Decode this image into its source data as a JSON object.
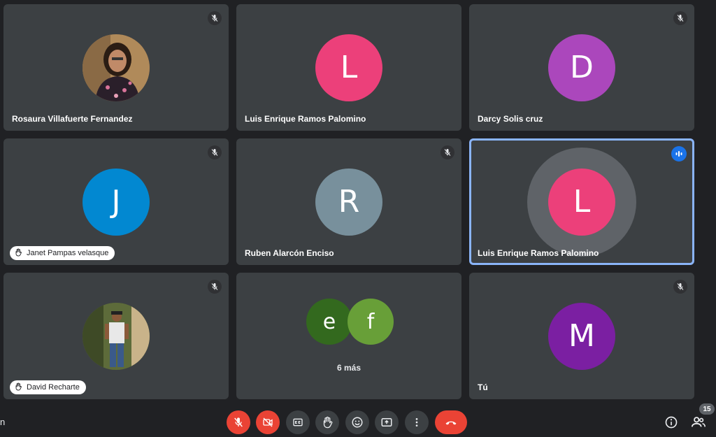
{
  "tiles": [
    {
      "name": "Rosaura Villafuerte Fernandez",
      "muted": true
    },
    {
      "name": "Luis Enrique Ramos Palomino",
      "initial": "L",
      "color": "#ec407a",
      "muted": false
    },
    {
      "name": "Darcy Solis cruz",
      "initial": "D",
      "color": "#ab47bc",
      "muted": true
    },
    {
      "name": "Janet Pampas velasque",
      "initial": "J",
      "color": "#0288d1",
      "muted": true,
      "hand_raised": true
    },
    {
      "name": "Ruben Alarcón Enciso",
      "initial": "R",
      "color": "#78909c",
      "muted": true
    },
    {
      "name": "Luis Enrique Ramos Palomino",
      "initial": "L",
      "color": "#ec407a",
      "speaking": true
    },
    {
      "name": "David Recharte",
      "muted": true,
      "hand_raised": true
    },
    {
      "more": "6 más",
      "initials": [
        "e",
        "f"
      ],
      "colors": [
        "#33691e",
        "#689f38"
      ]
    },
    {
      "name": "Tú",
      "initial": "M",
      "color": "#7b1fa2",
      "muted": true
    }
  ],
  "left_fragment": "n",
  "controls": [
    "mic-off",
    "camera-off",
    "captions",
    "raise-hand",
    "emoji",
    "present",
    "more",
    "leave-call"
  ],
  "participants_count": "15",
  "accent": {
    "danger": "#ea4335",
    "speaking_border": "#8ab4f8",
    "talk_badge": "#1a73e8"
  }
}
